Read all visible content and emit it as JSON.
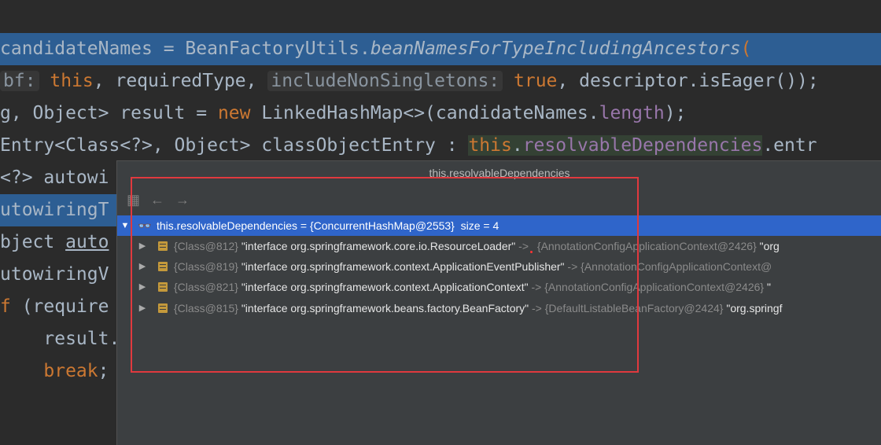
{
  "editor": {
    "lines": [
      {
        "segments": [
          {
            "text": "candidateNames = BeanFactoryUtils.",
            "cls": ""
          },
          {
            "text": "beanNamesForTypeIncludingAncestors",
            "cls": "it"
          },
          {
            "text": "(",
            "cls": "kw"
          }
        ]
      },
      {
        "segments": [
          {
            "text": "bf:",
            "cls": "hint"
          },
          {
            "text": " this",
            "cls": "kw"
          },
          {
            "text": ", requiredType, ",
            "cls": ""
          },
          {
            "text": "includeNonSingletons:",
            "cls": "hint"
          },
          {
            "text": " true",
            "cls": "kw"
          },
          {
            "text": ", descriptor.isEager());",
            "cls": ""
          }
        ]
      },
      {
        "segments": [
          {
            "text": "g, Object> result = ",
            "cls": ""
          },
          {
            "text": "new",
            "cls": "kw"
          },
          {
            "text": " LinkedHashMap<>(candidateNames.",
            "cls": ""
          },
          {
            "text": "length",
            "cls": "purple"
          },
          {
            "text": ");",
            "cls": ""
          }
        ]
      },
      {
        "segments": [
          {
            "text": "Entry<Class<?>, Object> classObjectEntry : ",
            "cls": ""
          },
          {
            "text": "this",
            "cls": "kw box-bg"
          },
          {
            "text": ".",
            "cls": "box-bg"
          },
          {
            "text": "resolvableDependencies",
            "cls": "purple box-bg"
          },
          {
            "text": ".entr",
            "cls": ""
          }
        ]
      },
      {
        "segments": [
          {
            "text": "<?> autowi",
            "cls": ""
          }
        ]
      },
      {
        "segments": [
          {
            "text": "utowiringT",
            "cls": ""
          }
        ]
      },
      {
        "segments": [
          {
            "text": "bject ",
            "cls": ""
          },
          {
            "text": "auto",
            "cls": "ul"
          }
        ]
      },
      {
        "segments": [
          {
            "text": "utowiringV",
            "cls": ""
          }
        ]
      },
      {
        "segments": [
          {
            "text": "f",
            "cls": "kw"
          },
          {
            "text": " (require",
            "cls": ""
          }
        ]
      },
      {
        "segments": [
          {
            "text": "    result.",
            "cls": ""
          }
        ]
      },
      {
        "segments": [
          {
            "text": "    ",
            "cls": ""
          },
          {
            "text": "break",
            "cls": "kw"
          },
          {
            "text": ";",
            "cls": ""
          }
        ]
      }
    ]
  },
  "popup": {
    "title": "this.resolvableDependencies",
    "toolbar_icons": [
      "copy-icon",
      "back-arrow-icon",
      "forward-arrow-icon"
    ],
    "root": {
      "name": "this.resolvableDependencies",
      "eq": " = ",
      "value": "{ConcurrentHashMap@2553}",
      "size": "size = 4"
    },
    "entries": [
      {
        "key_ref": "{Class@812}",
        "key_str": "\"interface org.springframework.core.io.ResourceLoader\"",
        "arrow": "->",
        "val_ref": "{AnnotationConfigApplicationContext@2426}",
        "val_str": "\"org"
      },
      {
        "key_ref": "{Class@819}",
        "key_str": "\"interface org.springframework.context.ApplicationEventPublisher\"",
        "arrow": "->",
        "val_ref": "{AnnotationConfigApplicationContext@",
        "val_str": ""
      },
      {
        "key_ref": "{Class@821}",
        "key_str": "\"interface org.springframework.context.ApplicationContext\"",
        "arrow": "->",
        "val_ref": "{AnnotationConfigApplicationContext@2426}",
        "val_str": "\""
      },
      {
        "key_ref": "{Class@815}",
        "key_str": "\"interface org.springframework.beans.factory.BeanFactory\"",
        "arrow": "->",
        "val_ref": "{DefaultListableBeanFactory@2424}",
        "val_str": "\"org.springf"
      }
    ]
  },
  "colors": {
    "highlight": "#2d5e93",
    "selection": "#2f65ca",
    "annotation_box": "#e0393e",
    "keyword": "#cc7832",
    "field": "#9876aa"
  }
}
